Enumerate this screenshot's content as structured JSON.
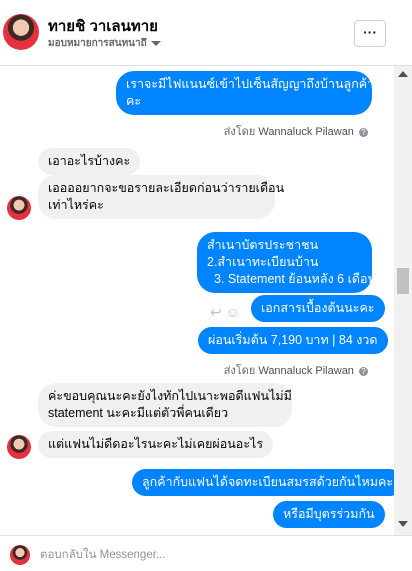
{
  "header": {
    "name": "ทายชิ วาเลนทาย",
    "subtitle": "มอบหมายการสนทนาถึ",
    "more_label": "···"
  },
  "messages": [
    {
      "lines": [
        "เราจะมีไฟแนนซ์เข้าไปเซ็นสัญญาถึงบ้านลูกค้านะ",
        "คะ"
      ]
    },
    {
      "text": "เอาอะไรบ้างคะ"
    },
    {
      "lines": [
        "เออออยากจะขอรายละเอียดก่อนว่ารายเดือน",
        "เท่าไหร่คะ"
      ]
    },
    {
      "lines": [
        "สำเนาบัตรประชาชน",
        "2.สำเนาทะเบียนบ้าน",
        "  3. Statement ย้อนหลัง 6 เดือน"
      ]
    },
    {
      "text": "เอกสารเบื้องต้นนะคะ"
    },
    {
      "text": "ผ่อนเริ่มต้น 7,190 บาท | 84 งวด"
    },
    {
      "lines": [
        "ค่ะขอบคุณนะคะยังไงทักไปเนาะพอดีแฟนไม่มี",
        "statement นะคะมีแต่ตัวพี่คนเดียว"
      ]
    },
    {
      "text": "แต่แฟนไม่ดีดอะไรนะคะไม่เคยผ่อนอะไร"
    },
    {
      "text": "ลูกค้ากับแฟนได้จดทะเบียนสมรสด้วยกันไหมคะ"
    },
    {
      "text": "หรือมีบุตรร่วมกัน"
    }
  ],
  "sent_by": {
    "prefix": "ส่งโดย",
    "name": "Wannaluck Pilawan",
    "info": "?"
  },
  "icons": {
    "reply": "↩",
    "react": "☺"
  },
  "composer": {
    "placeholder": "ตอบกลับใน Messenger..."
  }
}
